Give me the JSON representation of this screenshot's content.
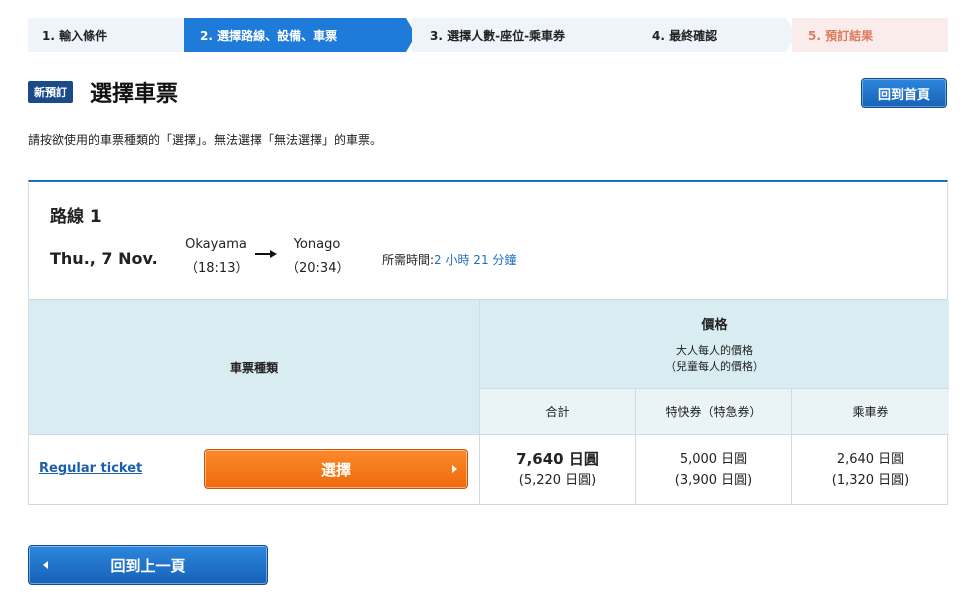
{
  "steps": [
    {
      "label": "1. 輸入條件"
    },
    {
      "label": "2. 選擇路線、設備、車票"
    },
    {
      "label": "3. 選擇人數-座位-乘車券"
    },
    {
      "label": "4. 最終確認"
    },
    {
      "label": "5. 預訂結果"
    }
  ],
  "header": {
    "badge": "新預訂",
    "title": "選擇車票",
    "home_button": "回到首頁"
  },
  "instruction": "請按欲使用的車票種類的「選擇」。無法選擇「無法選擇」的車票。",
  "route": {
    "title": "路線 1",
    "date": "Thu., 7 Nov.",
    "from_station": "Okayama",
    "from_time": "（18:13）",
    "to_station": "Yonago",
    "to_time": "（20:34）",
    "duration_label": "所需時間:",
    "duration_value": "2 小時 21 分鐘"
  },
  "fare_table": {
    "ticket_type_header": "車票種類",
    "price_header": "價格",
    "price_sub_adult": "大人每人的價格",
    "price_sub_child": "（兒童每人的價格）",
    "col_total": "合計",
    "col_express": "特快券（特急券）",
    "col_basic": "乘車券",
    "rows": [
      {
        "ticket_name": "Regular ticket",
        "select_label": "選擇",
        "total_adult": "7,640 日圓",
        "total_child": "(5,220 日圓)",
        "express_adult": "5,000 日圓",
        "express_child": "(3,900 日圓)",
        "basic_adult": "2,640 日圓",
        "basic_child": "(1,320 日圓)"
      }
    ]
  },
  "back_button": "回到上一頁",
  "colors": {
    "active_step": "#1e7bd9",
    "select_button": "#f47a1f",
    "primary_button": "#1e6fc4",
    "header_cell": "#d8ecf1"
  }
}
